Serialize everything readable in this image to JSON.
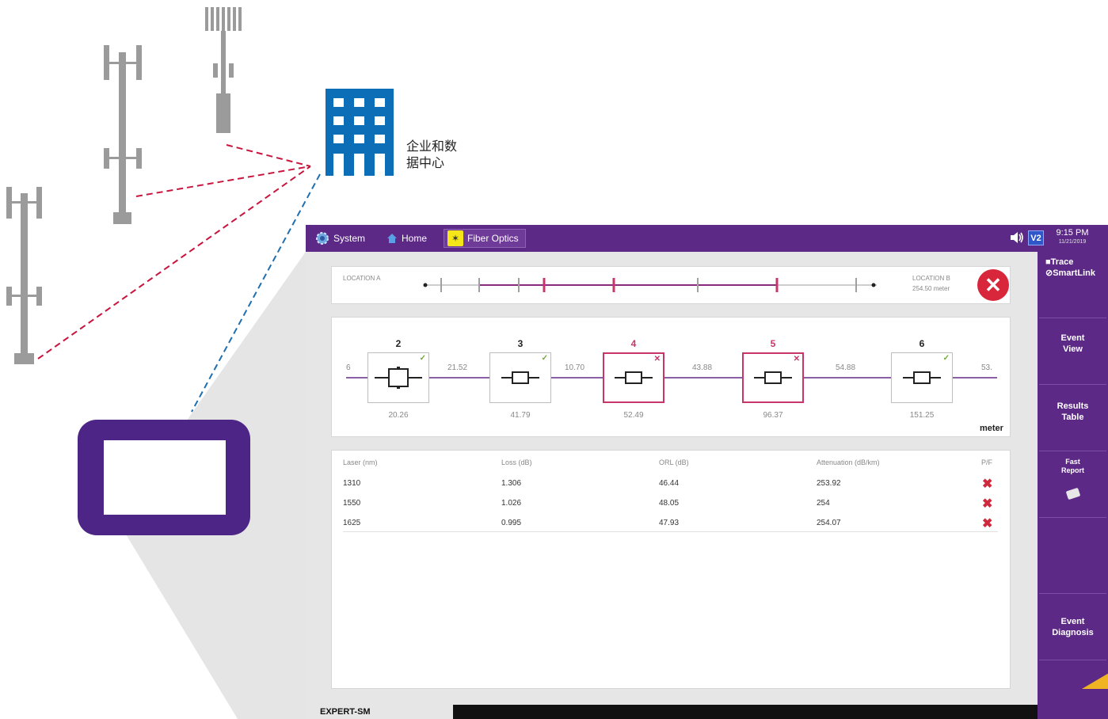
{
  "illustration": {
    "datacenter_label": [
      "企业和数",
      "据中心"
    ],
    "colors": {
      "tower": "#9a9a9a",
      "building": "#0b6eb6",
      "device": "#4d2586",
      "red_link": "#c8163f",
      "blue_link": "#1f6fb0"
    }
  },
  "topbar": {
    "tabs": [
      {
        "label": "System",
        "icon": "gear-icon"
      },
      {
        "label": "Home",
        "icon": "home-icon"
      },
      {
        "label": "Fiber Optics",
        "icon": "fiber-icon"
      }
    ],
    "badge": "V2",
    "time": "9:15 PM",
    "date": "11/21/2019"
  },
  "location": {
    "a_label": "LOCATION A",
    "b_label": "LOCATION B",
    "b_distance": "254.50 meter"
  },
  "events": [
    {
      "num": "2",
      "dist": "20.26",
      "status": "pass"
    },
    {
      "num": "3",
      "dist": "41.79",
      "status": "pass"
    },
    {
      "num": "4",
      "dist": "52.49",
      "status": "fail"
    },
    {
      "num": "5",
      "dist": "96.37",
      "status": "fail"
    },
    {
      "num": "6",
      "dist": "151.25",
      "status": "pass"
    }
  ],
  "segments": {
    "start": "6",
    "s1": "21.52",
    "s2": "10.70",
    "s3": "43.88",
    "s4": "54.88",
    "end": "53."
  },
  "unit": "meter",
  "table": {
    "headers": [
      "Laser (nm)",
      "Loss (dB)",
      "ORL (dB)",
      "Attenuation (dB/km)",
      "P/F"
    ],
    "rows": [
      [
        "1310",
        "1.306",
        "46.44",
        "253.92",
        "✖"
      ],
      [
        "1550",
        "1.026",
        "48.05",
        "254",
        "✖"
      ],
      [
        "1625",
        "0.995",
        "47.93",
        "254.07",
        "✖"
      ]
    ]
  },
  "sidebar": {
    "trace_1": "■Trace",
    "trace_2": "⊘SmartLink",
    "event_view": [
      "Event",
      "View"
    ],
    "results_table": [
      "Results",
      "Table"
    ],
    "fast_report": [
      "Fast",
      "Report"
    ],
    "event_diagnosis": [
      "Event",
      "Diagnosis"
    ]
  },
  "bottombar": {
    "label": "EXPERT-SM"
  }
}
